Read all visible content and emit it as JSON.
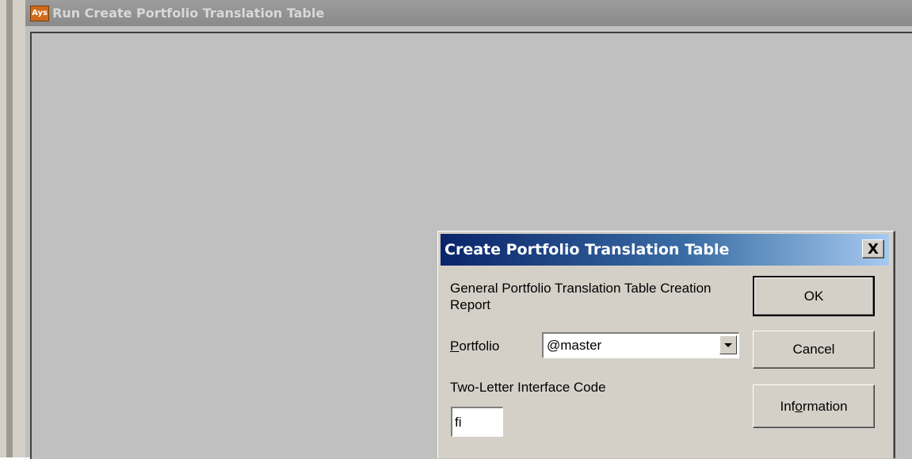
{
  "mdi": {
    "title": "Run Create Portfolio Translation Table",
    "icon_text": "Ays"
  },
  "dialog": {
    "title": "Create Portfolio Translation Table",
    "close_symbol": "X",
    "description": "General Portfolio Translation Table Creation Report",
    "portfolio_label_mnemonic": "P",
    "portfolio_label_rest": "ortfolio",
    "portfolio_value": "@master",
    "code_label": "Two-Letter Interface Code",
    "code_value": "fi",
    "buttons": {
      "ok": "OK",
      "cancel": "Cancel",
      "info_before": "Inf",
      "info_mnemonic": "o",
      "info_after": "rmation"
    }
  },
  "colors": {
    "dialog_title_start": "#0a246a",
    "dialog_title_end": "#a6caf0",
    "face": "#d4d0c8",
    "mdi_client": "#c0c0c0"
  }
}
